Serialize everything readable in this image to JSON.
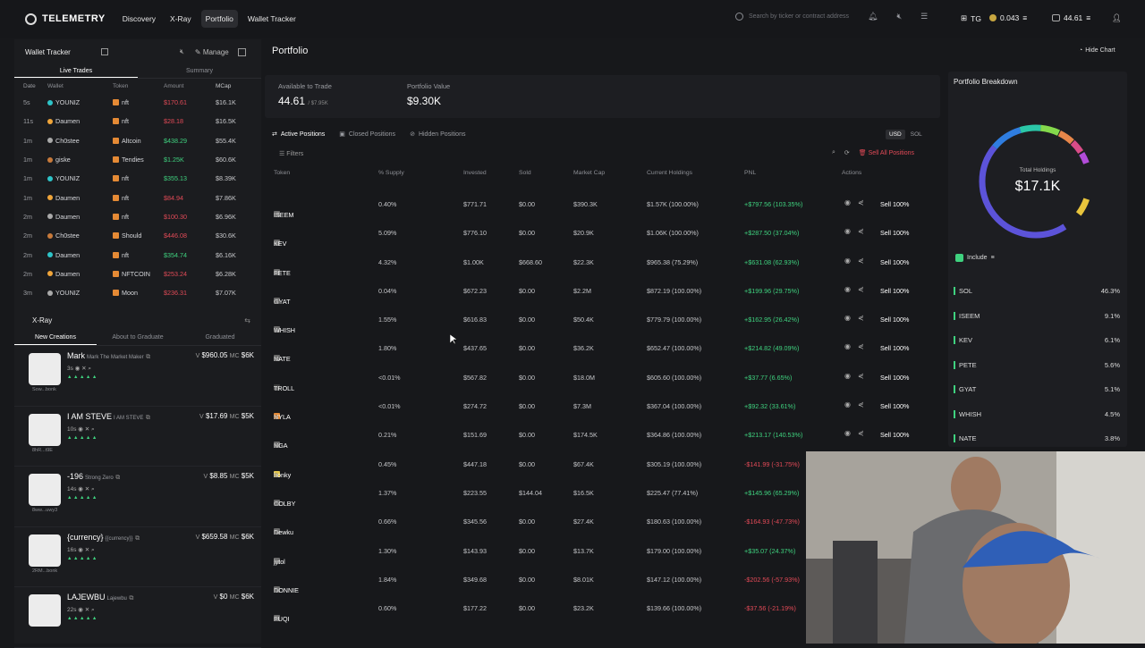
{
  "topbar": {
    "logo": "TELEMETRY",
    "nav": [
      "Discovery",
      "X-Ray",
      "Portfolio",
      "Wallet Tracker"
    ],
    "search_placeholder": "Search by ticker or contract address",
    "user": "TG",
    "sol_balance": "0.043",
    "wallet_balance": "44.61"
  },
  "wallet_tracker": {
    "title": "Wallet Tracker",
    "manage": "Manage",
    "tabs": [
      "Live Trades",
      "Summary"
    ],
    "columns": [
      "Date",
      "Wallet",
      "Token",
      "Amount",
      "MCap"
    ],
    "rows": [
      {
        "date": "5s",
        "wallet": "YOUNIZ",
        "token": "nft",
        "amount": "$170.61",
        "mcap": "$16.1K",
        "side": "sell"
      },
      {
        "date": "11s",
        "wallet": "Daumen",
        "token": "nft",
        "amount": "$28.18",
        "mcap": "$16.5K",
        "side": "sell"
      },
      {
        "date": "1m",
        "wallet": "Ch0stee",
        "token": "Altcoin",
        "amount": "$438.29",
        "mcap": "$55.4K",
        "side": "buy"
      },
      {
        "date": "1m",
        "wallet": "giske",
        "token": "Tendies",
        "amount": "$1.25K",
        "mcap": "$60.6K",
        "side": "buy"
      },
      {
        "date": "1m",
        "wallet": "YOUNIZ",
        "token": "nft",
        "amount": "$355.13",
        "mcap": "$8.39K",
        "side": "buy"
      },
      {
        "date": "1m",
        "wallet": "Daumen",
        "token": "nft",
        "amount": "$84.94",
        "mcap": "$7.86K",
        "side": "sell"
      },
      {
        "date": "2m",
        "wallet": "Daumen",
        "token": "nft",
        "amount": "$100.30",
        "mcap": "$6.96K",
        "side": "sell"
      },
      {
        "date": "2m",
        "wallet": "Ch0stee",
        "token": "Should",
        "amount": "$446.08",
        "mcap": "$30.6K",
        "side": "sell"
      },
      {
        "date": "2m",
        "wallet": "Daumen",
        "token": "nft",
        "amount": "$354.74",
        "mcap": "$6.16K",
        "side": "buy"
      },
      {
        "date": "2m",
        "wallet": "Daumen",
        "token": "NFTCOIN",
        "amount": "$253.24",
        "mcap": "$6.28K",
        "side": "sell"
      },
      {
        "date": "3m",
        "wallet": "YOUNIZ",
        "token": "Moon",
        "amount": "$236.31",
        "mcap": "$7.07K",
        "side": "sell"
      }
    ]
  },
  "xray": {
    "title": "X-Ray",
    "tabs": [
      "New Creations",
      "About to Graduate",
      "Graduated"
    ],
    "cards": [
      {
        "name": "Mark",
        "sub": "Mark The Market Maker",
        "age": "3s",
        "v": "$960.05",
        "mc": "$6K",
        "creator": "Sow...bonk"
      },
      {
        "name": "I AM STEVE",
        "sub": "I AM STEVE",
        "age": "10s",
        "v": "$17.69",
        "mc": "$5K",
        "creator": "8hR...t9E"
      },
      {
        "name": "-196",
        "sub": "Strong Zero",
        "age": "14s",
        "v": "$8.85",
        "mc": "$5K",
        "creator": "8ww...uwy3"
      },
      {
        "name": "{currency}",
        "sub": "{{currency}}",
        "age": "16s",
        "v": "$659.58",
        "mc": "$6K",
        "creator": "2RM...bonk"
      },
      {
        "name": "LAJEWBU",
        "sub": "Lajewbu",
        "age": "22s",
        "v": "$0",
        "mc": "$6K",
        "creator": ""
      }
    ]
  },
  "portfolio": {
    "title": "Portfolio",
    "hide_chart": "Hide Chart",
    "available_label": "Available to Trade",
    "available_value": "44.61",
    "available_sub": "/ $7.95K",
    "value_label": "Portfolio Value",
    "value": "$9.30K",
    "tabs": [
      "Active Positions",
      "Closed Positions",
      "Hidden Positions"
    ],
    "currency": [
      "USD",
      "SOL"
    ],
    "filters": "Filters",
    "sell_all": "Sell All Positions",
    "columns": [
      "Token",
      "% Supply",
      "Invested",
      "Sold",
      "Market Cap",
      "Current Holdings",
      "PNL",
      "Actions"
    ],
    "rows": [
      {
        "token": "ISEEM",
        "supply": "0.40%",
        "invested": "$771.71",
        "sold": "$0.00",
        "mcap": "$390.3K",
        "holdings": "$1.57K (100.00%)",
        "pnl": "+$797.56 (103.35%)",
        "pos": true
      },
      {
        "token": "KEV",
        "supply": "5.09%",
        "invested": "$776.10",
        "sold": "$0.00",
        "mcap": "$20.9K",
        "holdings": "$1.06K (100.00%)",
        "pnl": "+$287.50 (37.04%)",
        "pos": true
      },
      {
        "token": "PETE",
        "supply": "4.32%",
        "invested": "$1.00K",
        "sold": "$668.60",
        "mcap": "$22.3K",
        "holdings": "$965.38 (75.29%)",
        "pnl": "+$631.08 (62.93%)",
        "pos": true
      },
      {
        "token": "GYAT",
        "supply": "0.04%",
        "invested": "$672.23",
        "sold": "$0.00",
        "mcap": "$2.2M",
        "holdings": "$872.19 (100.00%)",
        "pnl": "+$199.96 (29.75%)",
        "pos": true
      },
      {
        "token": "WHISH",
        "supply": "1.55%",
        "invested": "$616.83",
        "sold": "$0.00",
        "mcap": "$50.4K",
        "holdings": "$779.79 (100.00%)",
        "pnl": "+$162.95 (26.42%)",
        "pos": true
      },
      {
        "token": "NATE",
        "supply": "1.80%",
        "invested": "$437.65",
        "sold": "$0.00",
        "mcap": "$36.2K",
        "holdings": "$652.47 (100.00%)",
        "pnl": "+$214.82 (49.09%)",
        "pos": true
      },
      {
        "token": "TROLL",
        "supply": "<0.01%",
        "invested": "$567.82",
        "sold": "$0.00",
        "mcap": "$18.0M",
        "holdings": "$605.60 (100.00%)",
        "pnl": "+$37.77 (6.65%)",
        "pos": true
      },
      {
        "token": "NYLA",
        "supply": "<0.01%",
        "invested": "$274.72",
        "sold": "$0.00",
        "mcap": "$7.3M",
        "holdings": "$367.04 (100.00%)",
        "pnl": "+$92.32 (33.61%)",
        "pos": true
      },
      {
        "token": "NGA",
        "supply": "0.21%",
        "invested": "$151.69",
        "sold": "$0.00",
        "mcap": "$174.5K",
        "holdings": "$364.86 (100.00%)",
        "pnl": "+$213.17 (140.53%)",
        "pos": true
      },
      {
        "token": "bonky",
        "supply": "0.45%",
        "invested": "$447.18",
        "sold": "$0.00",
        "mcap": "$67.4K",
        "holdings": "$305.19 (100.00%)",
        "pnl": "-$141.99 (-31.75%)",
        "pos": false
      },
      {
        "token": "COLBY",
        "supply": "1.37%",
        "invested": "$223.55",
        "sold": "$144.04",
        "mcap": "$16.5K",
        "holdings": "$225.47 (77.41%)",
        "pnl": "+$145.96 (65.29%)",
        "pos": true
      },
      {
        "token": "Dewku",
        "supply": "0.66%",
        "invested": "$345.56",
        "sold": "$0.00",
        "mcap": "$27.4K",
        "holdings": "$180.63 (100.00%)",
        "pnl": "-$164.93 (-47.73%)",
        "pos": false
      },
      {
        "token": "jytol",
        "supply": "1.30%",
        "invested": "$143.93",
        "sold": "$0.00",
        "mcap": "$13.7K",
        "holdings": "$179.00 (100.00%)",
        "pnl": "+$35.07 (24.37%)",
        "pos": true
      },
      {
        "token": "DONNIE",
        "supply": "1.84%",
        "invested": "$349.68",
        "sold": "$0.00",
        "mcap": "$8.01K",
        "holdings": "$147.12 (100.00%)",
        "pnl": "-$202.56 (-57.93%)",
        "pos": false
      },
      {
        "token": "PUQI",
        "supply": "0.60%",
        "invested": "$177.22",
        "sold": "$0.00",
        "mcap": "$23.2K",
        "holdings": "$139.66 (100.00%)",
        "pnl": "-$37.56 (-21.19%)",
        "pos": false
      }
    ]
  },
  "breakdown": {
    "title": "Portfolio Breakdown",
    "total_label": "Total Holdings",
    "total_value": "$17.1K",
    "include": "Include",
    "items": [
      {
        "name": "SOL",
        "pct": "46.3%"
      },
      {
        "name": "ISEEM",
        "pct": "9.1%"
      },
      {
        "name": "KEV",
        "pct": "6.1%"
      },
      {
        "name": "PETE",
        "pct": "5.6%"
      },
      {
        "name": "GYAT",
        "pct": "5.1%"
      },
      {
        "name": "WHISH",
        "pct": "4.5%"
      },
      {
        "name": "NATE",
        "pct": "3.8%"
      }
    ]
  },
  "actions": {
    "sell_label": "Sell 100%"
  }
}
